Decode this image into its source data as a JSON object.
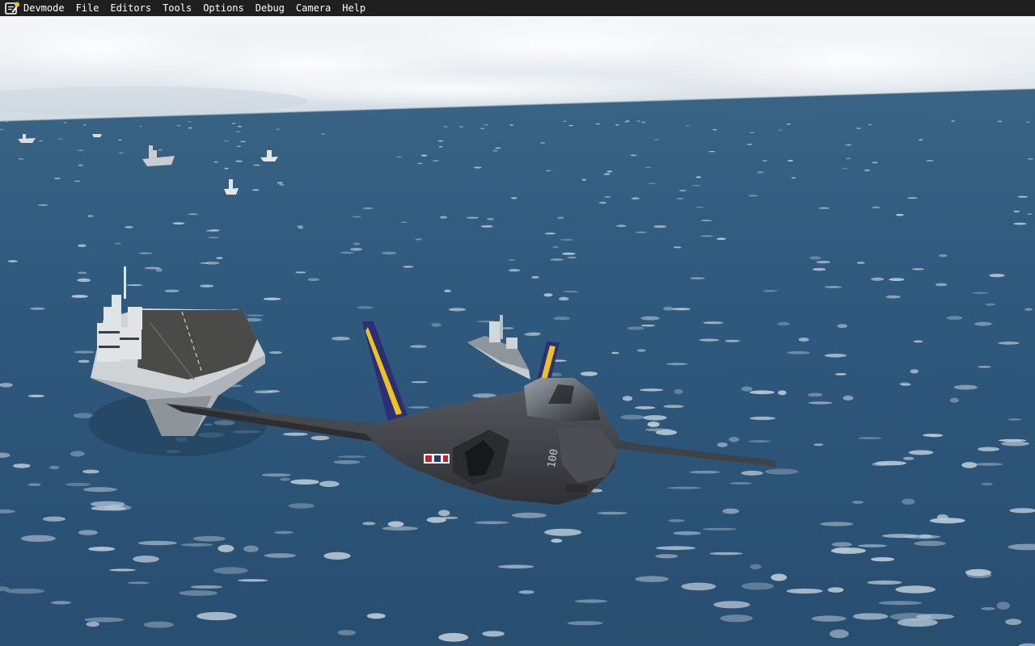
{
  "app": {
    "icon": "devmode-notepad-icon",
    "notification_color": "#f5c400"
  },
  "menubar": {
    "items": [
      {
        "label": "Devmode",
        "name": "menu-devmode"
      },
      {
        "label": "File",
        "name": "menu-file"
      },
      {
        "label": "Editors",
        "name": "menu-editors"
      },
      {
        "label": "Tools",
        "name": "menu-tools"
      },
      {
        "label": "Options",
        "name": "menu-options"
      },
      {
        "label": "Debug",
        "name": "menu-debug"
      },
      {
        "label": "Camera",
        "name": "menu-camera"
      },
      {
        "label": "Help",
        "name": "menu-help"
      }
    ]
  },
  "scene": {
    "sky_color": "#e8eef3",
    "sea_color": "#2f5a7e",
    "jet_color": "#3d3f44",
    "tail_stripe_colors": [
      "#2b2f78",
      "#f2c21a"
    ],
    "carrier_deck_color": "#4a4a48",
    "hull_color": "#d7dbde",
    "jet_tail_number": "100"
  }
}
